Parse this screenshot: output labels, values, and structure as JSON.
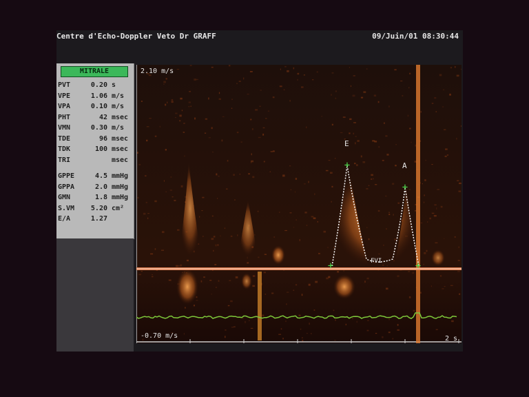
{
  "header": {
    "clinic": "Centre d'Echo-Doppler Veto Dr GRAFF",
    "datetime": "09/Juin/01 08:30:44"
  },
  "panel": {
    "mode": "MITRALE",
    "measurements": [
      {
        "name": "PVT",
        "value": "0.20",
        "unit": "s"
      },
      {
        "name": "VPE",
        "value": "1.06",
        "unit": "m/s"
      },
      {
        "name": "VPA",
        "value": "0.10",
        "unit": "m/s"
      },
      {
        "name": "PHT",
        "value": "42",
        "unit": "msec"
      },
      {
        "name": "VMN",
        "value": "0.30",
        "unit": "m/s"
      },
      {
        "name": "TDE",
        "value": "96",
        "unit": "msec"
      },
      {
        "name": "TDK",
        "value": "100",
        "unit": "msec"
      },
      {
        "name": "TRI",
        "value": "",
        "unit": "msec"
      },
      {
        "name": "GPPE",
        "value": "4.5",
        "unit": "mmHg"
      },
      {
        "name": "GPPA",
        "value": "2.0",
        "unit": "mmHg"
      },
      {
        "name": "GMN",
        "value": "1.8",
        "unit": "mmHg"
      },
      {
        "name": "S.VM",
        "value": "5.20",
        "unit": "cm²"
      },
      {
        "name": "E/A",
        "value": "1.27",
        "unit": ""
      }
    ]
  },
  "spectrogram": {
    "scale_top": "2.10 m/s",
    "scale_bottom": "-0.70 m/s",
    "time_label": "2 s",
    "marker_e": "E",
    "marker_a": "A",
    "trace_label": "FVI"
  },
  "colors": {
    "baseline": "#f08a5a",
    "ecg": "#7ec83a",
    "cursor": "#4ee04e",
    "trace": "#ffffff",
    "doppler": "#e07a30",
    "mode_button": "#3cb85a"
  }
}
